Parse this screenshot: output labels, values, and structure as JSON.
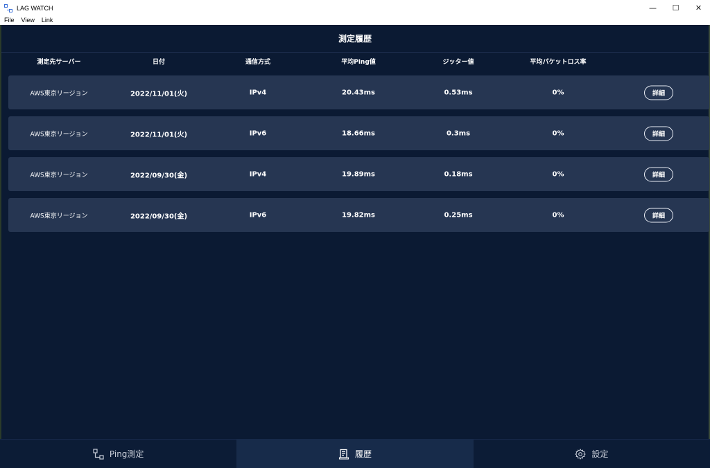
{
  "window": {
    "title": "LAG WATCH",
    "minimize": "—",
    "maximize": "☐",
    "close": "✕"
  },
  "menu": [
    "File",
    "View",
    "Link"
  ],
  "page": {
    "title": "測定履歴"
  },
  "columns": {
    "server": "測定先サーバー",
    "date": "日付",
    "protocol": "通信方式",
    "ping": "平均Ping値",
    "jitter": "ジッター値",
    "loss": "平均パケットロス率"
  },
  "rows": [
    {
      "server": "AWS東京リージョン",
      "date": "2022/11/01(火)",
      "protocol": "IPv4",
      "ping": "20.43ms",
      "jitter": "0.53ms",
      "loss": "0%",
      "detail": "詳細"
    },
    {
      "server": "AWS東京リージョン",
      "date": "2022/11/01(火)",
      "protocol": "IPv6",
      "ping": "18.66ms",
      "jitter": "0.3ms",
      "loss": "0%",
      "detail": "詳細"
    },
    {
      "server": "AWS東京リージョン",
      "date": "2022/09/30(金)",
      "protocol": "IPv4",
      "ping": "19.89ms",
      "jitter": "0.18ms",
      "loss": "0%",
      "detail": "詳細"
    },
    {
      "server": "AWS東京リージョン",
      "date": "2022/09/30(金)",
      "protocol": "IPv6",
      "ping": "19.82ms",
      "jitter": "0.25ms",
      "loss": "0%",
      "detail": "詳細"
    }
  ],
  "nav": {
    "ping": {
      "label": "Ping測定",
      "icon": "connection-icon"
    },
    "history": {
      "label": "履歴",
      "icon": "history-icon"
    },
    "settings": {
      "label": "設定",
      "icon": "gear-icon"
    }
  },
  "colors": {
    "background": "#0b1a33",
    "row": "#263652",
    "active_tab": "#172b4a"
  }
}
